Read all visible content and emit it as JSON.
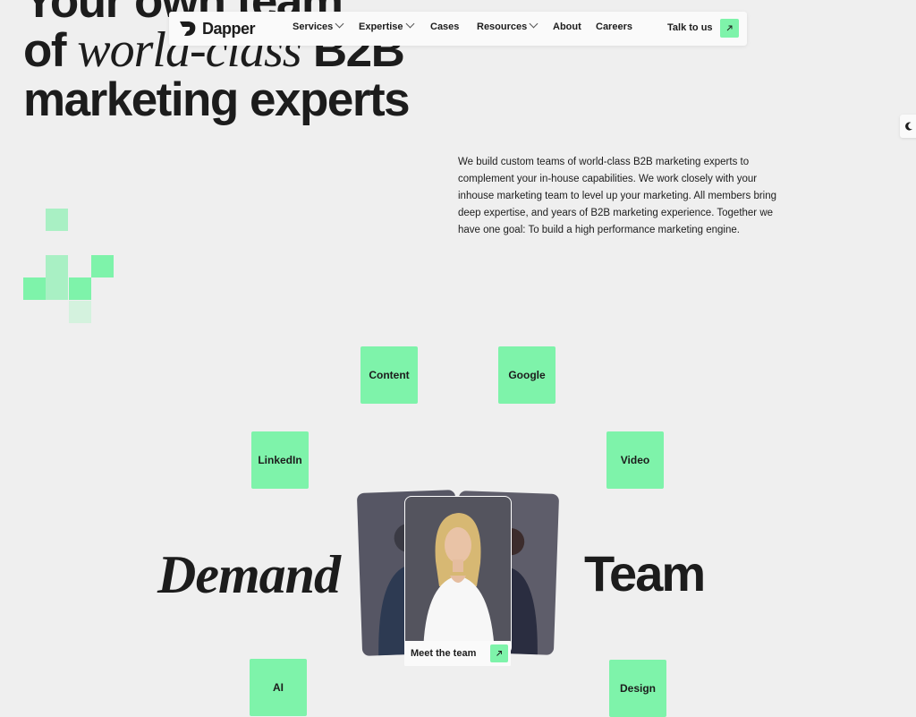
{
  "hero": {
    "line1": "Your own team",
    "line2_prefix": "of ",
    "line2_italic": "world-class",
    "line2_suffix": " B2B",
    "line3": "marketing experts"
  },
  "nav": {
    "brand": "Dapper",
    "items": [
      {
        "label": "Services",
        "has_dropdown": true
      },
      {
        "label": "Expertise",
        "has_dropdown": true
      },
      {
        "label": "Cases",
        "has_dropdown": false
      },
      {
        "label": "Resources",
        "has_dropdown": true
      },
      {
        "label": "About",
        "has_dropdown": false
      },
      {
        "label": "Careers",
        "has_dropdown": false
      }
    ],
    "cta_label": "Talk to us"
  },
  "intro": {
    "text": "We build custom teams of world-class B2B marketing experts to complement your in-house capabilities. We work closely with your inhouse marketing team to level up your marketing. All members bring deep expertise, and years of B2B marketing experience. Together we have one goal: To build a high performance marketing engine."
  },
  "tags": [
    "Content",
    "Google",
    "LinkedIn",
    "Video",
    "AI",
    "Design"
  ],
  "orbit": {
    "left_word": "Demand",
    "right_word": "Team",
    "meet_label": "Meet the team"
  },
  "colors": {
    "accent": "#7ef3aa",
    "background": "#efefef",
    "text": "#1c1c1c"
  }
}
